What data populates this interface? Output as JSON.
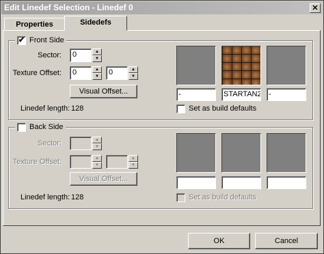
{
  "window": {
    "title": "Edit Linedef Selection - Linedef 0",
    "close_glyph": "✕"
  },
  "tabs": [
    {
      "label": "Properties",
      "active": false
    },
    {
      "label": "Sidedefs",
      "active": true
    }
  ],
  "front": {
    "enabled_label": "Front Side",
    "checked": true,
    "check_glyph": "✔",
    "sector_label": "Sector:",
    "sector_value": "0",
    "texture_offset_label": "Texture Offset:",
    "offset_x": "0",
    "offset_y": "0",
    "visual_offset_label": "Visual Offset...",
    "linedef_length_label": "Linedef length:",
    "linedef_length_value": "128",
    "textures": {
      "upper": "-",
      "middle": "STARTAN2",
      "lower": "-"
    },
    "build_defaults_label": "Set as build defaults",
    "build_defaults_checked": false
  },
  "back": {
    "enabled_label": "Back Side",
    "checked": false,
    "sector_label": "Sector:",
    "sector_value": "",
    "texture_offset_label": "Texture Offset:",
    "offset_x": "",
    "offset_y": "",
    "visual_offset_label": "Visual Offset...",
    "linedef_length_label": "Linedef length:",
    "linedef_length_value": "128",
    "textures": {
      "upper": "",
      "middle": "",
      "lower": ""
    },
    "build_defaults_label": "Set as build defaults",
    "build_defaults_checked": false
  },
  "buttons": {
    "ok": "OK",
    "cancel": "Cancel"
  },
  "spinner": {
    "up": "▲",
    "down": "▼"
  }
}
